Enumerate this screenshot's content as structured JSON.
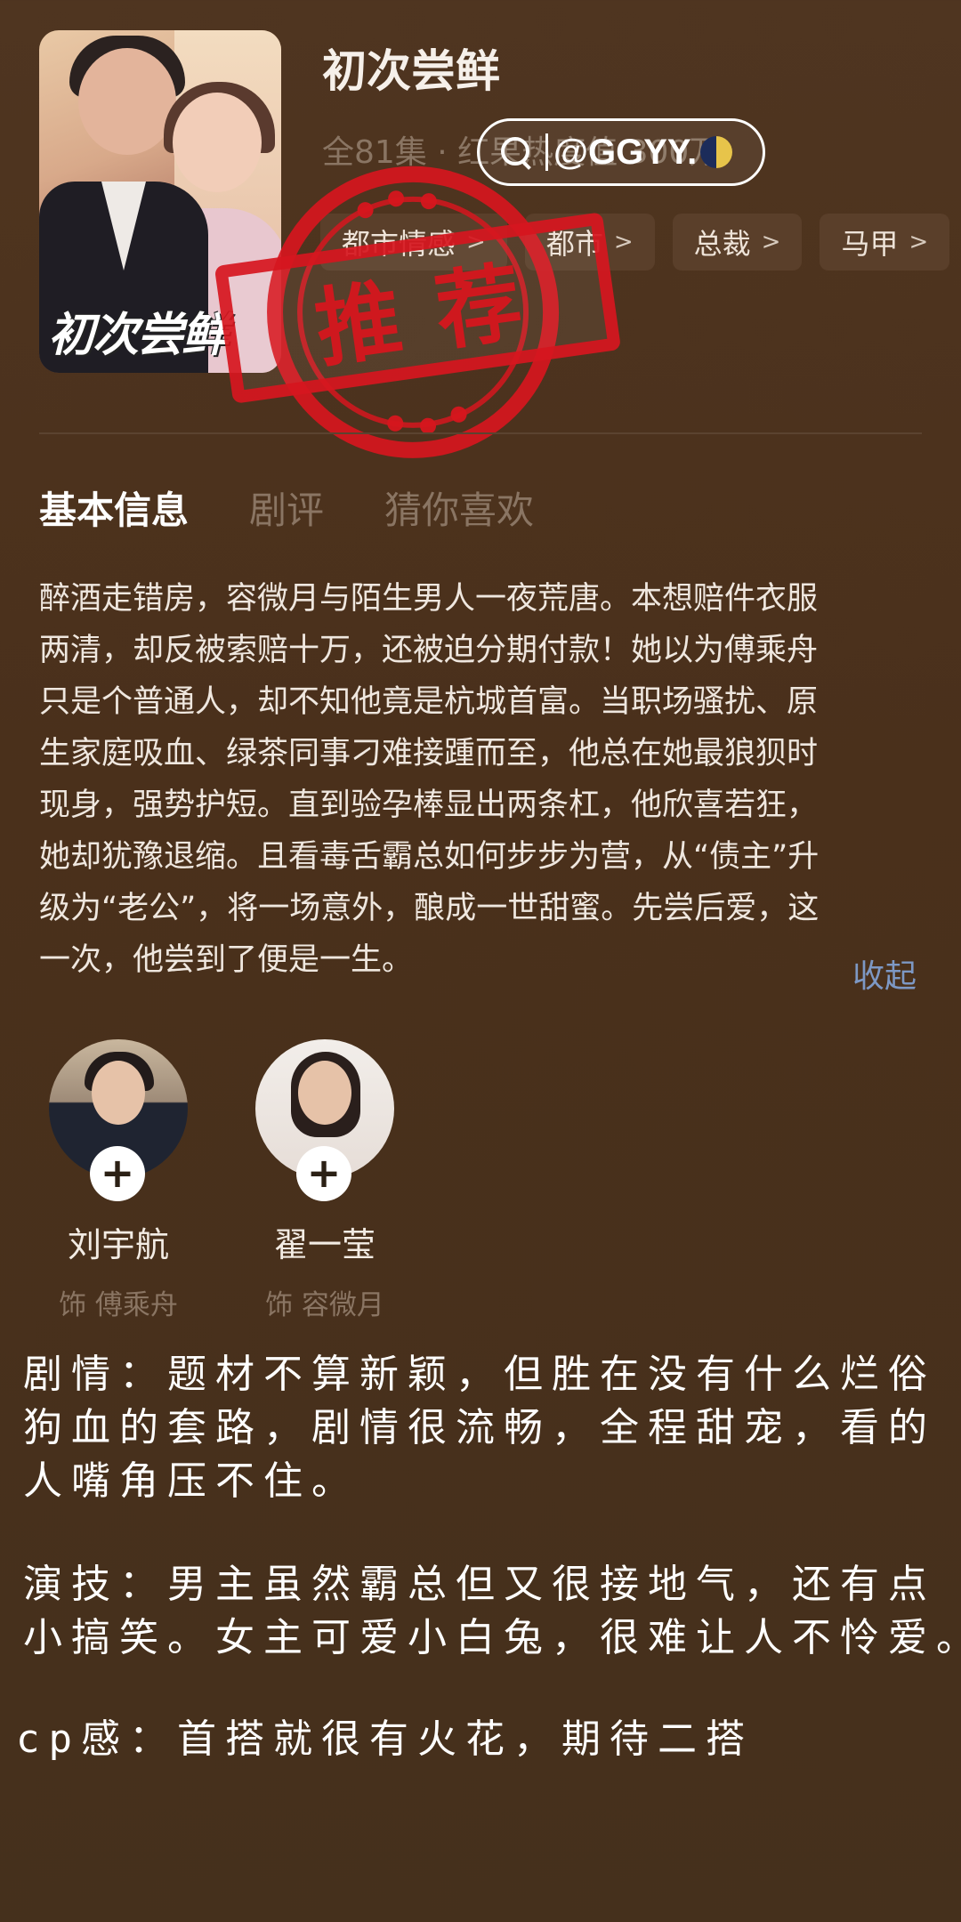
{
  "drama": {
    "title": "初次尝鲜",
    "meta": "全81集 · 红果热度值 300万",
    "poster_title": "初次尝鲜",
    "tags": [
      {
        "label": "都市情感"
      },
      {
        "label": "都市"
      },
      {
        "label": "总裁"
      },
      {
        "label": "马甲"
      }
    ]
  },
  "watermark": {
    "handle": "@GGYY.",
    "search_icon": "search-icon"
  },
  "stamp": {
    "text": "推荐",
    "color": "#d6161e"
  },
  "tabs": [
    {
      "label": "基本信息",
      "active": true
    },
    {
      "label": "剧评",
      "active": false
    },
    {
      "label": "猜你喜欢",
      "active": false
    }
  ],
  "synopsis": {
    "lines": [
      "醉酒走错房，容微月与陌生男人一夜荒唐。本想赔件衣服",
      "两清，却反被索赔十万，还被迫分期付款！她以为傅乘舟",
      "只是个普通人，却不知他竟是杭城首富。当职场骚扰、原",
      "生家庭吸血、绿茶同事刁难接踵而至，他总在她最狼狈时",
      "现身，强势护短。直到验孕棒显出两条杠，他欣喜若狂，",
      "她却犹豫退缩。且看毒舌霸总如何步步为营，从“债主”升",
      "级为“老公”，将一场意外，酿成一世甜蜜。先尝后爱，这",
      "一次，他尝到了便是一生。"
    ],
    "collapse_label": "收起"
  },
  "cast": [
    {
      "name": "刘宇航",
      "role": "饰 傅乘舟",
      "follow_label": "+"
    },
    {
      "name": "翟一莹",
      "role": "饰 容微月",
      "follow_label": "+"
    }
  ],
  "notes": [
    "剧情：题材不算新颖，但胜在没有什么烂俗",
    "狗血的套路，剧情很流畅，全程甜宠，看的",
    "人嘴角压不住。",
    "演技：男主虽然霸总但又很接地气，还有点",
    "小搞笑。女主可爱小白兔，很难让人不怜爱。",
    "cp感：首搭就很有火花，期待二搭"
  ],
  "colors": {
    "background": "#4a301b",
    "link": "#7d98c4",
    "muted": "#8a7563"
  }
}
